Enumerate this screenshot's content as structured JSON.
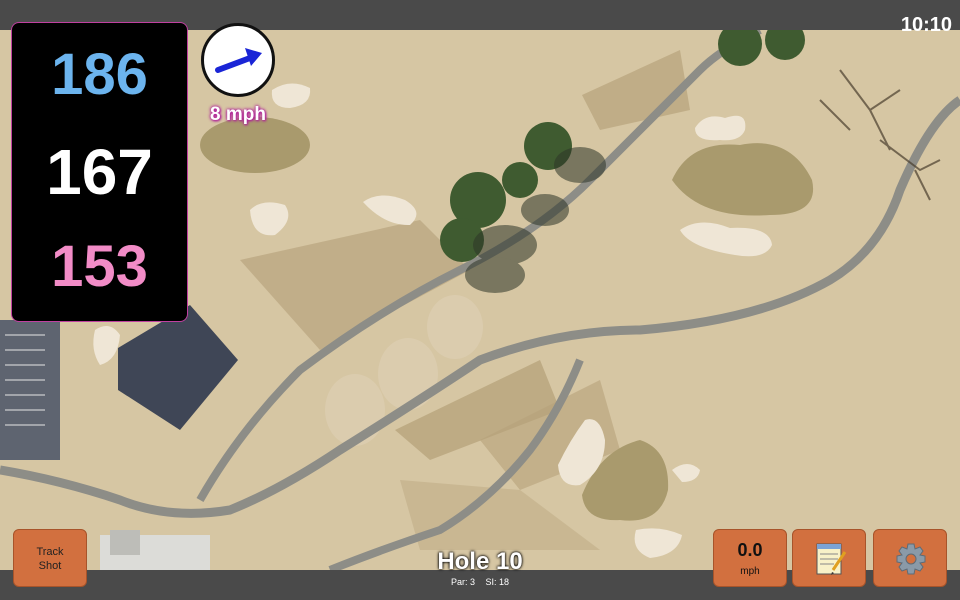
{
  "status": {
    "time": "10:10"
  },
  "yardage": {
    "back": "186",
    "middle": "167",
    "front": "153"
  },
  "wind": {
    "speed_label": "8 mph",
    "icon": "wind-arrow-icon"
  },
  "hole": {
    "title": "Hole 10",
    "par_label": "Par: 3",
    "si_label": "SI: 18"
  },
  "buttons": {
    "track_shot_line1": "Track",
    "track_shot_line2": "Shot",
    "speed_value": "0.0",
    "speed_unit": "mph",
    "notes_icon": "notepad-icon",
    "settings_icon": "gear-icon"
  },
  "colors": {
    "back_yardage": "#6cb4ee",
    "middle_yardage": "#ffffff",
    "front_yardage": "#f28cc7",
    "button_bg": "#d2703f",
    "accent_border": "#c040a0"
  }
}
